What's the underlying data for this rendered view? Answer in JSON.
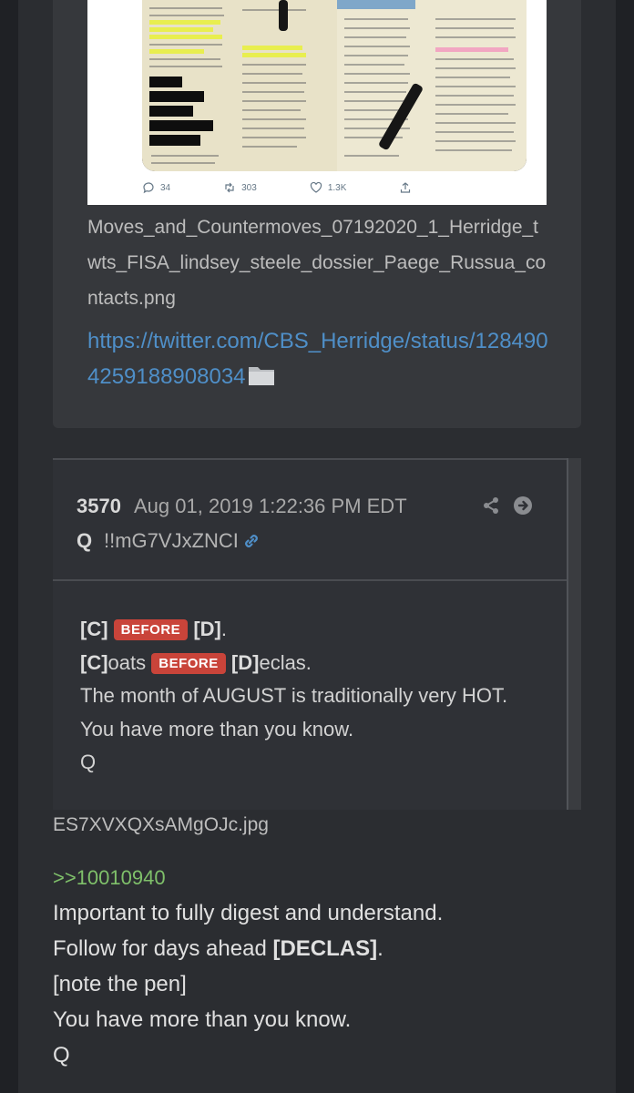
{
  "tweet": {
    "reply_count": "34",
    "retweet_count": "303",
    "like_count": "1.3K"
  },
  "attachment": {
    "filename": "Moves_and_Countermoves_07192020_1_Herridge_twts_FISA_lindsey_steele_dossier_Paege_Russua_contacts.png",
    "link": "https://twitter.com/CBS_Herridge/status/1284904259188908034",
    "folder_icon": "folder-icon"
  },
  "q_post": {
    "number": "3570",
    "timestamp": "Aug 01, 2019 1:22:36 PM EDT",
    "author": "Q",
    "tripcode": "!!mG7VJxZNCI",
    "lines": [
      {
        "pre": "[C]",
        "badge": "BEFORE",
        "post": "[D]",
        "tail": "."
      },
      {
        "pre": "[C]",
        "pre_tail": "oats",
        "badge": "BEFORE",
        "post": "[D]",
        "tail": "eclas."
      }
    ],
    "line3": "The month of AUGUST is traditionally very HOT.",
    "line4": "You have more than you know.",
    "line5": "Q"
  },
  "image_caption": "ES7XVXQXsAMgOJc.jpg",
  "reply": {
    "quote_ref": ">>10010940",
    "line1": "Important to fully digest and understand.",
    "line2_pre": "Follow for days ahead ",
    "line2_tag": "[DECLAS]",
    "line2_post": ".",
    "line3": "[note the pen]",
    "line4": "You have more than you know.",
    "line5": "Q"
  },
  "colors": {
    "background": "#1f2125",
    "panel": "#2b2d31",
    "link": "#4f8fc8",
    "badge": "#c9443a",
    "quote": "#7fc06a"
  }
}
